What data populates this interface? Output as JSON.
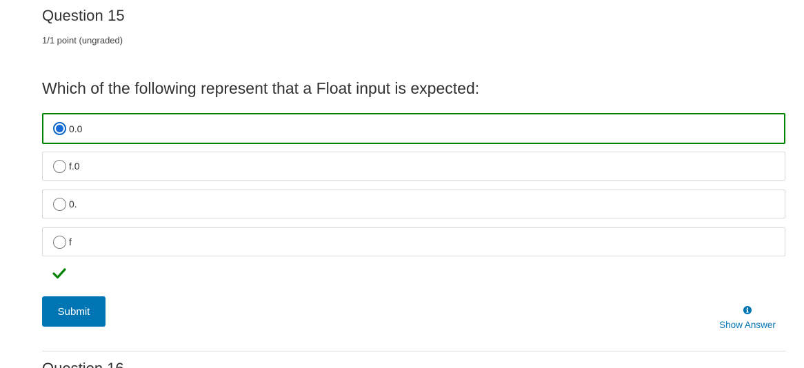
{
  "problem": {
    "title": "Question 15",
    "points": "1/1 point (ungraded)",
    "prompt": "Which of the following represent that a Float input is expected:",
    "choices": [
      {
        "label": "0.0",
        "selected": true
      },
      {
        "label": "f.0",
        "selected": false
      },
      {
        "label": "0.",
        "selected": false
      },
      {
        "label": "f",
        "selected": false
      }
    ],
    "status_icon": "checkmark-icon",
    "status_color": "#008100"
  },
  "actions": {
    "submit_label": "Submit",
    "show_answer_label": "Show Answer",
    "show_answer_icon": "info-icon",
    "accent_color": "#0075b4"
  },
  "next_problem": {
    "title": "Question 16"
  }
}
